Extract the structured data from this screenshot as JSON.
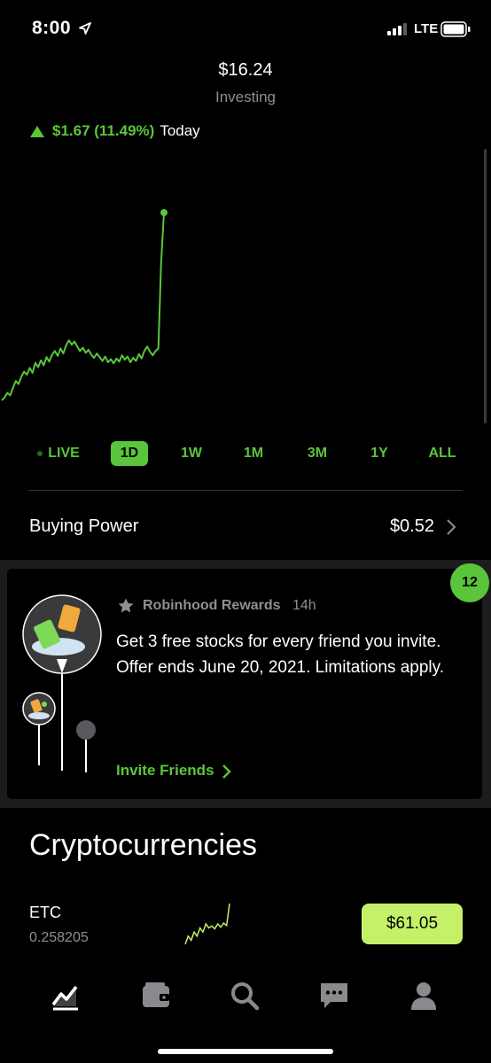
{
  "status_bar": {
    "time": "8:00",
    "network": "LTE"
  },
  "header": {
    "portfolio_value": "$16.24",
    "subtitle": "Investing",
    "change_value": "$1.67 (11.49%)",
    "change_period": "Today"
  },
  "chart_data": {
    "type": "line",
    "title": "",
    "series": [
      {
        "values": [
          0.0,
          0.5,
          1.2,
          0.8,
          2.0,
          3.1,
          2.6,
          3.8,
          4.6,
          4.1,
          5.2,
          4.4,
          6.0,
          5.3,
          6.4,
          5.6,
          6.9,
          6.2,
          7.3,
          7.9,
          7.1,
          8.3,
          7.5,
          8.8,
          9.6,
          8.9,
          9.4,
          8.6,
          7.9,
          8.4,
          7.6,
          8.1,
          7.3,
          6.8,
          7.5,
          6.9,
          6.3,
          7.0,
          6.1,
          6.6,
          5.9,
          6.7,
          6.2,
          7.2,
          6.5,
          7.0,
          6.1,
          6.8,
          6.3,
          7.4,
          6.7,
          7.9,
          8.6,
          7.8,
          7.2,
          7.9,
          8.3,
          22.0,
          30.0
        ],
        "color": "#5ac53b"
      }
    ],
    "grid": false,
    "legend": "none"
  },
  "ranges": [
    "LIVE",
    "1D",
    "1W",
    "1M",
    "3M",
    "1Y",
    "ALL"
  ],
  "active_range": "1D",
  "buying_power": {
    "label": "Buying Power",
    "value": "$0.52"
  },
  "rewards_card": {
    "badge_count": "12",
    "title": "Robinhood Rewards",
    "time": "14h",
    "body": "Get 3 free stocks for every friend you invite. Offer ends June 20, 2021. Limitations apply.",
    "action": "Invite Friends"
  },
  "crypto": {
    "heading": "Cryptocurrencies",
    "items": [
      {
        "symbol": "ETC",
        "quantity": "0.258205",
        "price": "$61.05",
        "sparkline": [
          0,
          2,
          1,
          3,
          2,
          4,
          3,
          5,
          4,
          4.5,
          3.8,
          5,
          4.2,
          5.2,
          4.6,
          10
        ]
      }
    ]
  },
  "tab_bar": [
    "chart-icon",
    "wallet-icon",
    "search-icon",
    "messages-icon",
    "account-icon"
  ],
  "colors": {
    "accent": "#5ac53b",
    "crypto_accent": "#c5f06a",
    "background": "#000000",
    "muted": "#8f8f94"
  }
}
